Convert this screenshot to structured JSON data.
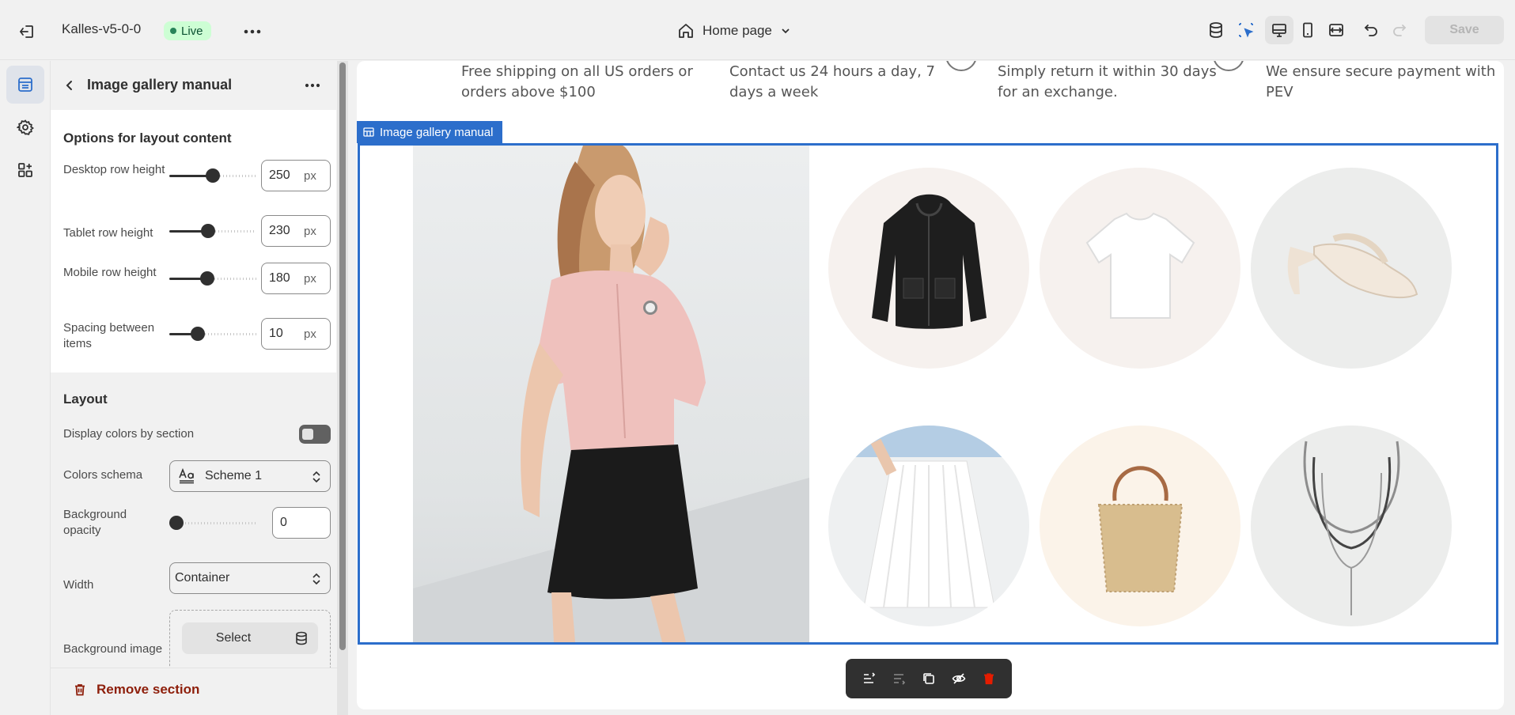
{
  "topbar": {
    "store_name": "Kalles-v5-0-0",
    "status": "Live",
    "page_selector": "Home page",
    "save_label": "Save"
  },
  "panel": {
    "title": "Image gallery manual",
    "options_title": "Options for layout content",
    "rows": [
      {
        "label": "Desktop row height",
        "value": "250",
        "unit": "px",
        "level": 0.5
      },
      {
        "label": "Tablet row height",
        "value": "230",
        "unit": "px",
        "level": 0.44
      },
      {
        "label": "Mobile row height",
        "value": "180",
        "unit": "px",
        "level": 0.42
      },
      {
        "label": "Spacing between items",
        "value": "10",
        "unit": "px",
        "level": 0.29
      }
    ],
    "layout_title": "Layout",
    "display_colors_label": "Display colors by section",
    "display_colors_on": false,
    "colors_schema_label": "Colors schema",
    "colors_schema_value": "Scheme 1",
    "bg_opacity_label": "Background opacity",
    "bg_opacity_value": "0",
    "width_label": "Width",
    "width_value": "Container",
    "bg_image_label": "Background image",
    "bg_image_select": "Select",
    "remove_label": "Remove section"
  },
  "preview": {
    "usp": [
      {
        "text": "Free shipping on all US orders or orders above $100"
      },
      {
        "text": "Contact us 24 hours a day, 7 days a week"
      },
      {
        "text": "Simply return it within 30 days for an exchange."
      },
      {
        "text": "We ensure secure payment with PEV"
      }
    ],
    "section_tab": "Image gallery manual",
    "products": [
      "jacket",
      "t-shirt",
      "heeled-sandal",
      "skirt",
      "tote-bag",
      "necklace"
    ]
  },
  "colors": {
    "accent": "#2c6ecb",
    "live_bg": "#cdfed4",
    "danger": "#8e1f0b"
  }
}
